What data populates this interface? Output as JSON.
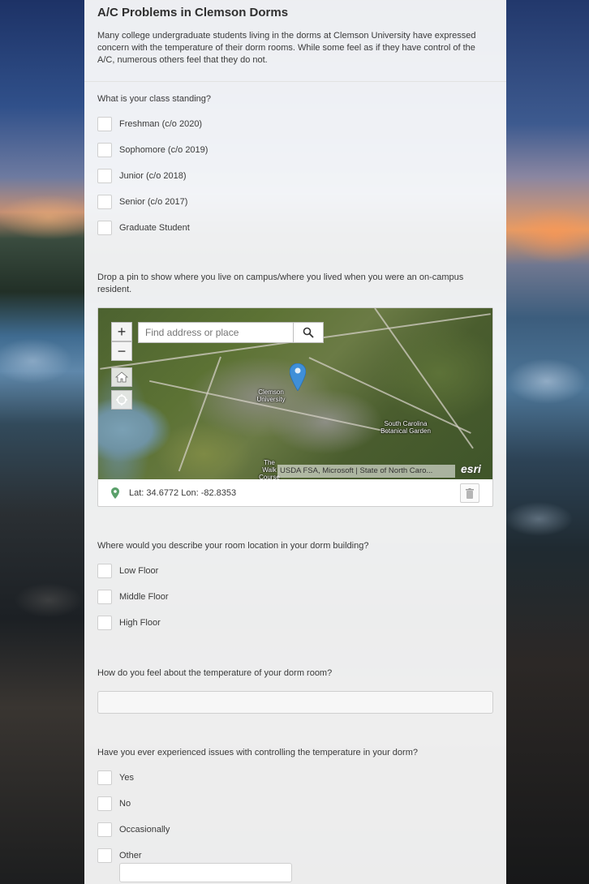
{
  "form": {
    "title": "A/C Problems in Clemson Dorms",
    "description": "Many college undergraduate students living in the dorms at Clemson University have expressed concern with the temperature of their dorm rooms. While some feel as if they have control of the A/C, numerous others feel that they do not."
  },
  "q1": {
    "label": "What is your class standing?",
    "options": [
      "Freshman (c/o 2020)",
      "Sophomore (c/o 2019)",
      "Junior (c/o 2018)",
      "Senior (c/o 2017)",
      "Graduate Student"
    ]
  },
  "q2": {
    "label": "Drop a pin to show where you live on campus/where you lived when you were an on-campus resident.",
    "map": {
      "search_placeholder": "Find address or place",
      "zoom_in": "+",
      "zoom_out": "−",
      "labels": {
        "clemson": "Clemson University",
        "garden": "South Carolina Botanical Garden",
        "walk": "The Walk Course"
      },
      "attribution": "USDA FSA, Microsoft | State of North Caro...",
      "logo": "esri"
    },
    "coords": "Lat: 34.6772 Lon: -82.8353"
  },
  "q3": {
    "label": "Where would you describe your room location in your dorm building?",
    "options": [
      "Low Floor",
      "Middle Floor",
      "High Floor"
    ]
  },
  "q4": {
    "label": "How do you feel about the temperature of your dorm room?",
    "value": ""
  },
  "q5": {
    "label": "Have you ever experienced issues with controlling the temperature in your dorm?",
    "options": [
      "Yes",
      "No",
      "Occasionally",
      "Other"
    ],
    "other_value": ""
  }
}
